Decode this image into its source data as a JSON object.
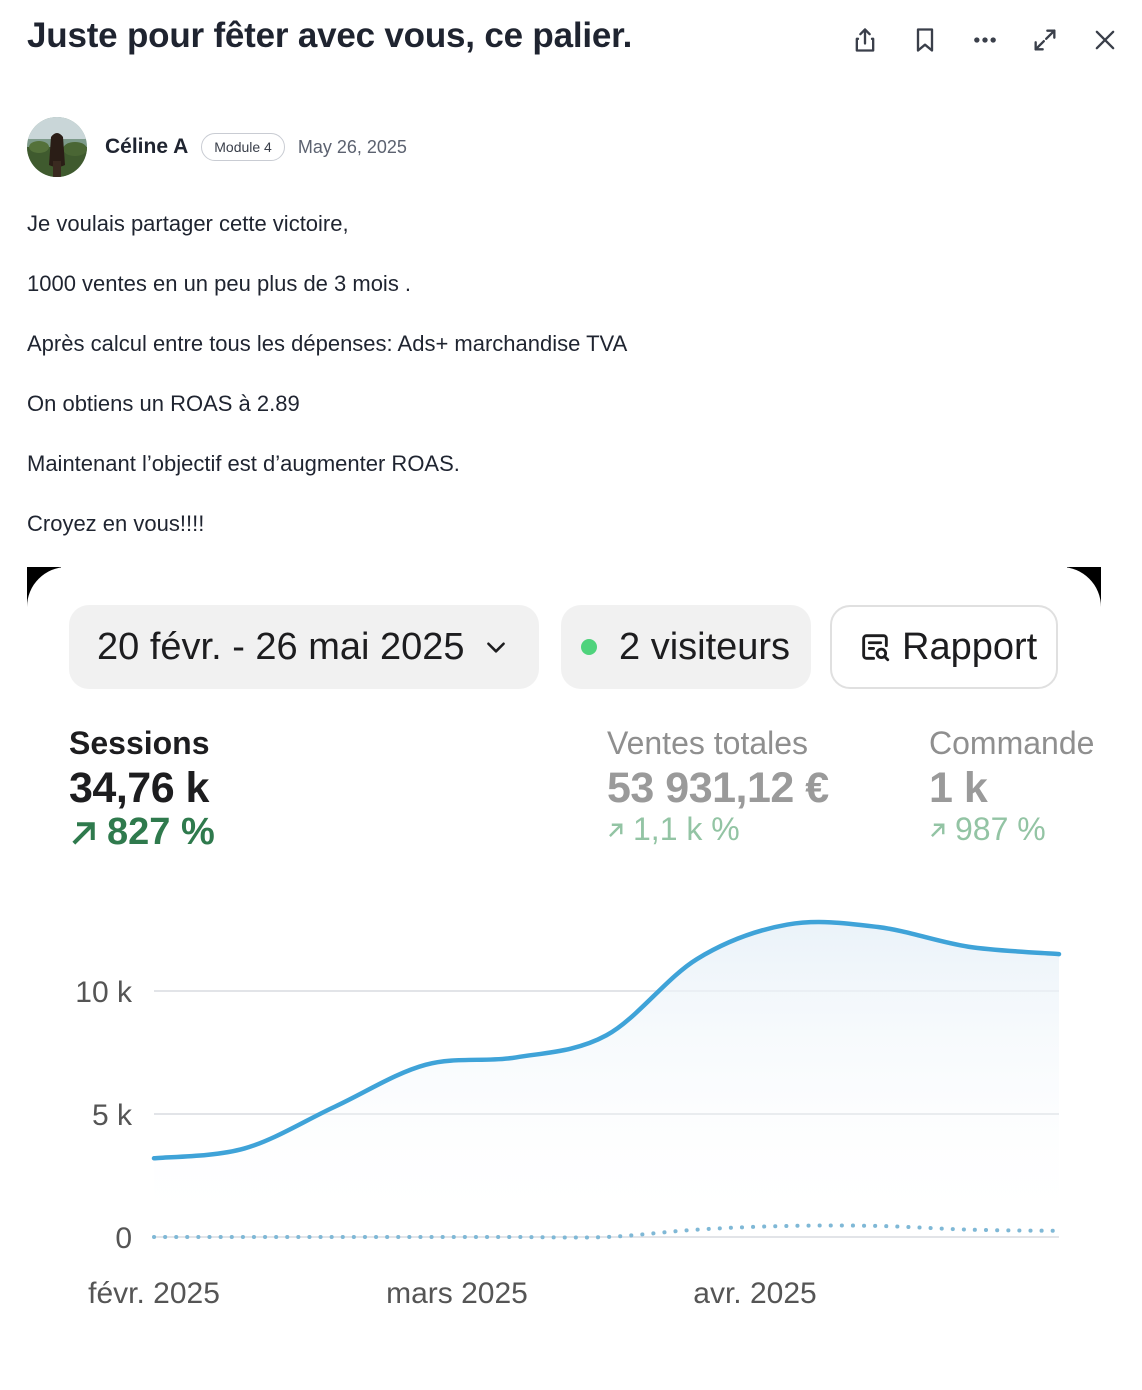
{
  "post": {
    "title": "Juste pour fêter avec vous, ce palier.",
    "author_name": "Céline A",
    "module_badge": "Module 4",
    "date": "May 26, 2025",
    "paragraphs": [
      "Je voulais partager cette victoire,",
      "1000 ventes en un peu plus de 3 mois .",
      "Après calcul entre tous les dépenses: Ads+ marchandise TVA",
      "On obtiens un ROAS à 2.89",
      "Maintenant l’objectif est d’augmenter ROAS.",
      "Croyez en vous!!!!"
    ]
  },
  "toolbar": {
    "icons": [
      "share-icon",
      "bookmark-icon",
      "more-icon",
      "expand-icon",
      "close-icon"
    ]
  },
  "analytics": {
    "date_range": "20 févr. - 26 mai 2025",
    "visitors": "2 visiteurs",
    "report_label": "Rapport",
    "metrics": {
      "sessions": {
        "label": "Sessions",
        "value": "34,76 k",
        "change": "827 %"
      },
      "sales": {
        "label": "Ventes totales",
        "value": "53 931,12 €",
        "change": "1,1 k %"
      },
      "orders": {
        "label": "Commande",
        "value": "1 k",
        "change": "987 %"
      }
    },
    "colors": {
      "line": "#3fa3d8",
      "positive": "#2f7a4d",
      "live_dot": "#4fd37c"
    }
  },
  "chart_data": {
    "type": "line",
    "x_labels": [
      "févr. 2025",
      "mars 2025",
      "avr. 2025"
    ],
    "y_ticks": [
      "0",
      "5 k",
      "10 k"
    ],
    "ylim": [
      0,
      13000
    ],
    "series": [
      {
        "values": [
          3200,
          3600,
          5300,
          7000,
          7300,
          8200,
          11300,
          12700,
          12600,
          11800,
          11500
        ],
        "style": "solid"
      },
      {
        "values": [
          0,
          0,
          0,
          0,
          0,
          0,
          300,
          450,
          450,
          300,
          250
        ],
        "style": "dotted"
      }
    ]
  }
}
